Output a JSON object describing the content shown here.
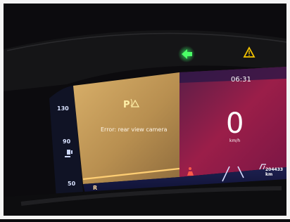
{
  "dashboard": {
    "fuel_scale": [
      "130",
      "90",
      "50"
    ],
    "error_message": "Error: rear view camera",
    "clock": "06:31",
    "speed": {
      "value": "0",
      "unit": "km/h"
    },
    "gear": "R",
    "odometer": "204433 km"
  },
  "colors": {
    "warning_panel": "#b8914e",
    "speed_panel": "#9b1e49",
    "turn_signal": "#35ff5a",
    "hazard": "#f5c400"
  },
  "icons": [
    "left-turn-arrow-icon",
    "hazard-triangle-icon",
    "parking-warning-icon",
    "seatbelt-warning-icon",
    "lane-assist-icon",
    "road-icon"
  ]
}
